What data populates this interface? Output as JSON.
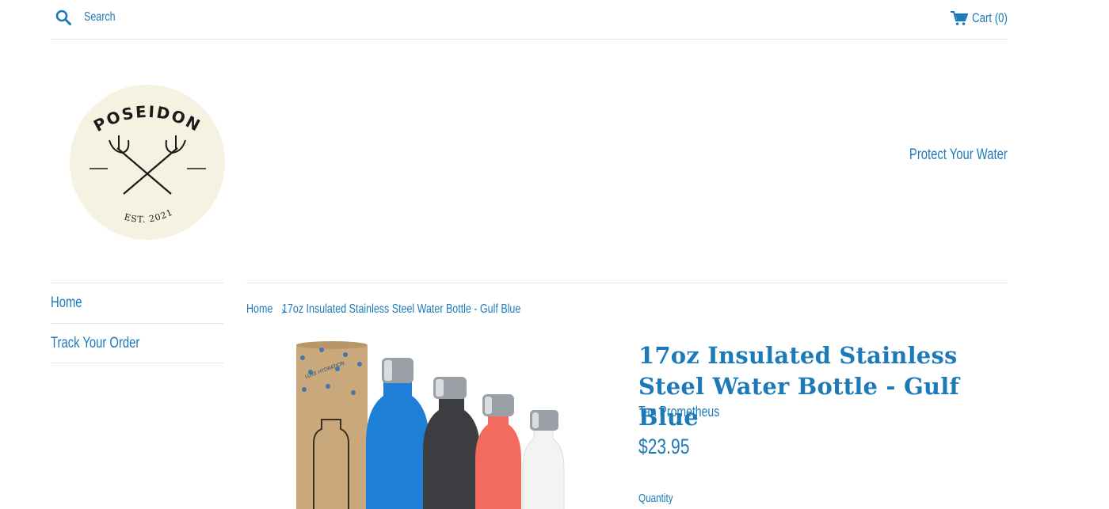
{
  "header": {
    "search_label": "Search",
    "cart_label": "Cart (0)"
  },
  "logo": {
    "brand": "POSEIDON",
    "established": "EST. 2021"
  },
  "tagline": "Protect Your Water",
  "sidebar": {
    "items": [
      {
        "label": "Home"
      },
      {
        "label": "Track Your Order"
      }
    ]
  },
  "breadcrumb": {
    "home": "Home",
    "separator": "›",
    "current": "17oz Insulated Stainless Steel Water Bottle - Gulf Blue"
  },
  "product": {
    "title": "17oz Insulated Stainless Steel Water Bottle - Gulf Blue",
    "vendor": "Tan Prometheus",
    "price": "$23.95",
    "quantity_label": "Quantity",
    "packaging_text": "LUXE HYDRATION"
  },
  "colors": {
    "accent": "#1c7ab8",
    "divider": "#e4e4e4",
    "logo_background": "#f6f2e2",
    "bottle_blue": "#1d7fd6",
    "bottle_black": "#3b3d40",
    "bottle_coral": "#f26b5e",
    "bottle_white": "#f3f4f2",
    "kraft_tube": "#c9a87c"
  }
}
